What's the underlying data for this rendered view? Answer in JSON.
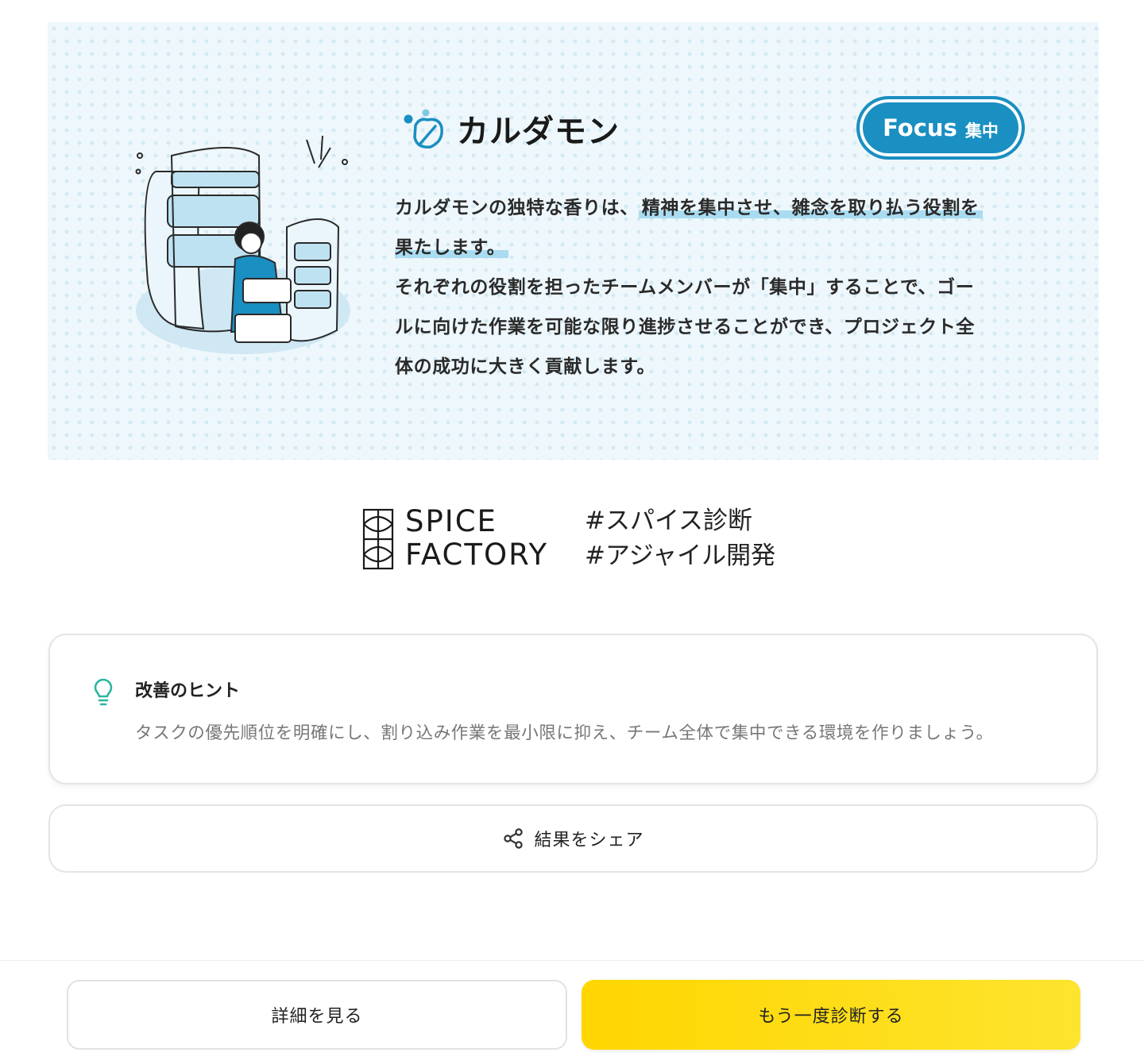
{
  "result": {
    "spice_name": "カルダモン",
    "badge": {
      "en": "Focus",
      "ja": "集中"
    },
    "description": {
      "prefix": "カルダモンの独特な香りは、",
      "highlight_1": "精神を集中させ、雑念を取り払う役割を",
      "highlight_2": "果たします。",
      "lines": [
        "それぞれの役割を担ったチームメンバーが「集中」することで、ゴー",
        "ルに向けた作業を可能な限り進捗させることができ、プロジェクト全",
        "体の成功に大きく貢献します。"
      ]
    }
  },
  "brand": {
    "line1": "SPICE",
    "line2": "FACTORY",
    "tags": [
      "#スパイス診断",
      "#アジャイル開発"
    ]
  },
  "hint": {
    "title": "改善のヒント",
    "body": "タスクの優先順位を明確にし、割り込み作業を最小限に抑え、チーム全体で集中できる環境を作りましょう。"
  },
  "share": {
    "label": "結果をシェア"
  },
  "footer": {
    "detail_label": "詳細を見る",
    "retry_label": "もう一度診断する"
  },
  "colors": {
    "accent": "#1a8fc1",
    "highlight": "#a9dcf1",
    "hint_icon": "#2bb5a0",
    "retry_button": "#ffd600"
  },
  "icons": [
    "cardamom-leaf-icon",
    "lightbulb-icon",
    "share-icon",
    "spice-factory-logo"
  ]
}
